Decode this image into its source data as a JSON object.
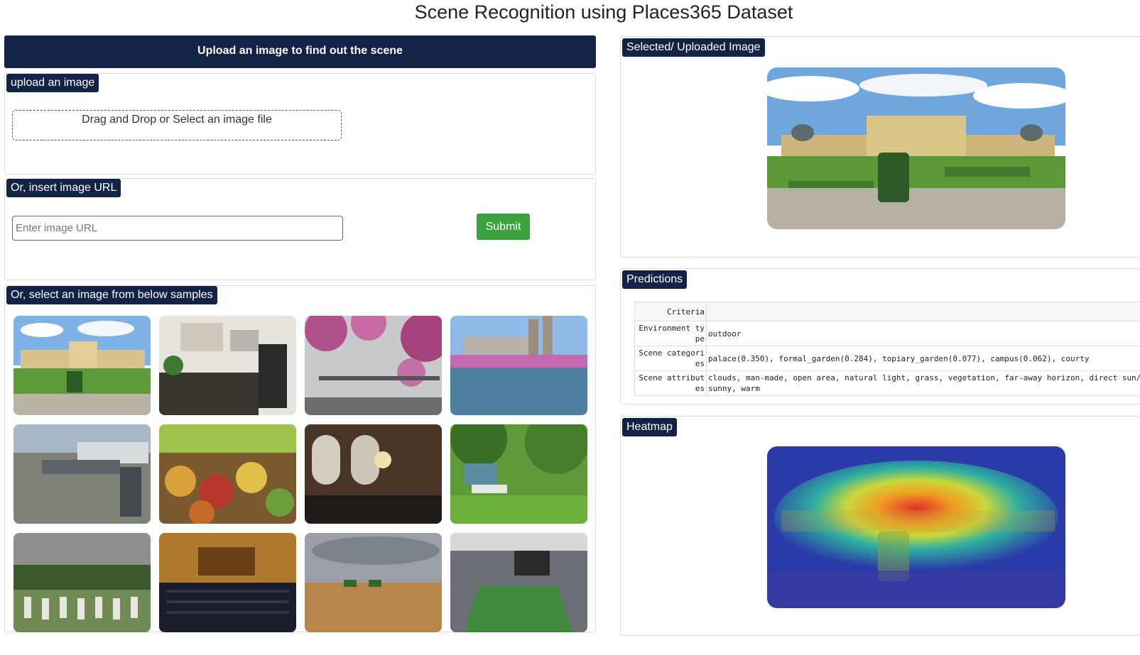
{
  "page": {
    "title": "Scene Recognition using Places365 Dataset"
  },
  "left": {
    "banner": "Upload an image to find out the scene",
    "upload": {
      "tag": "upload an image",
      "dropzone_text": "Drag and Drop or Select an image file"
    },
    "url": {
      "tag": "Or, insert image URL",
      "placeholder": "Enter image URL",
      "submit_label": "Submit"
    },
    "samples": {
      "tag": "Or, select an image from below samples",
      "items": [
        "palace-garden-thumbnail",
        "kitchen-thumbnail",
        "cherry-blossom-bridge-thumbnail",
        "city-lake-thumbnail",
        "airport-jet-bridge-thumbnail",
        "market-produce-thumbnail",
        "restaurant-hall-thumbnail",
        "house-lawn-thumbnail",
        "cemetery-thumbnail",
        "auditorium-thumbnail",
        "field-harvest-thumbnail",
        "stadium-thumbnail"
      ]
    }
  },
  "right": {
    "selected": {
      "tag": "Selected/ Uploaded Image"
    },
    "predictions": {
      "tag": "Predictions",
      "header": "Criteria",
      "rows": [
        {
          "key": "Environment type",
          "value": "outdoor"
        },
        {
          "key": "Scene categories",
          "value": "palace(0.350), formal_garden(0.284), topiary_garden(0.077), campus(0.062), courty"
        },
        {
          "key": "Scene attributes",
          "value": "clouds, man-made, open area, natural light, grass, vegetation, far-away horizon, direct sun/sunny, warm"
        }
      ]
    },
    "heatmap": {
      "tag": "Heatmap"
    }
  },
  "colors": {
    "navy": "#132347",
    "submit_green": "#3aa13f"
  }
}
